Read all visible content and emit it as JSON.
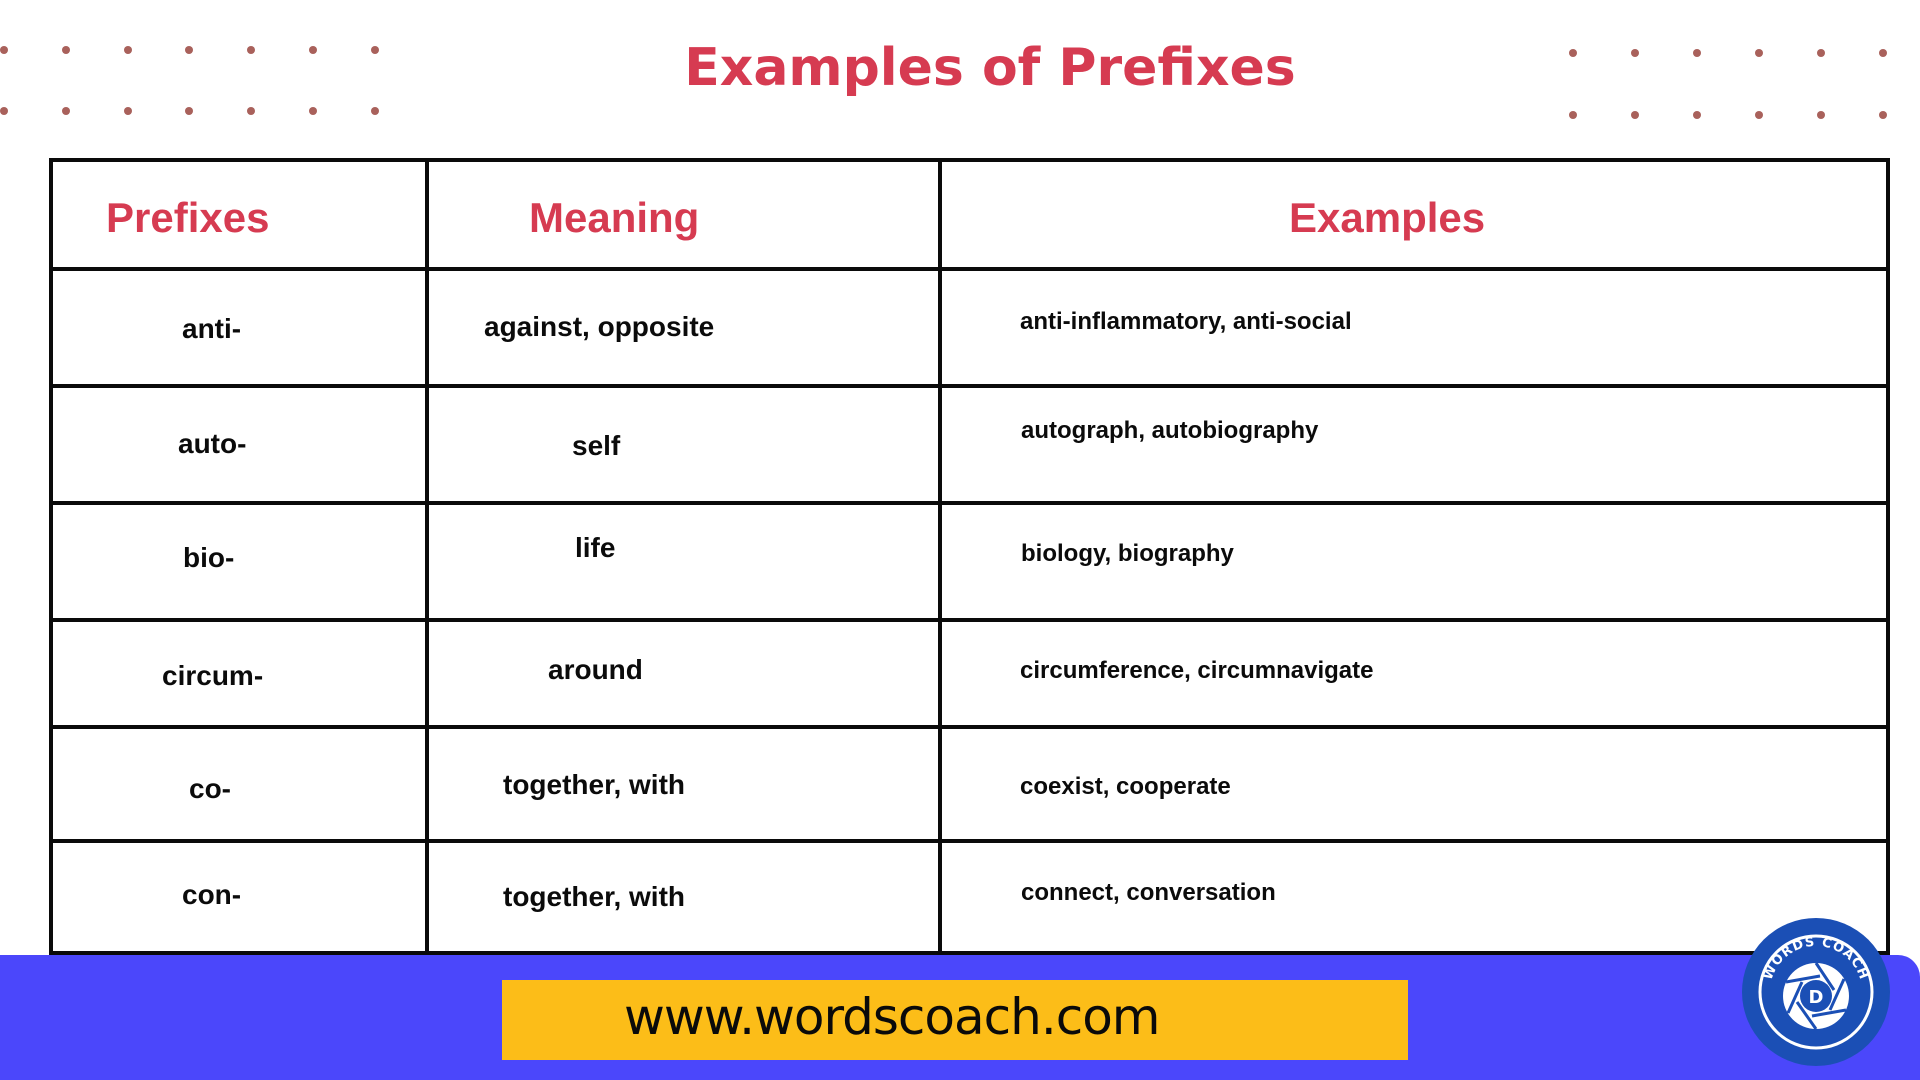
{
  "title": "Examples of Prefixes",
  "colors": {
    "title": "#d63b51",
    "header_text": "#d63b51",
    "dots": "#a9615b",
    "footer_band": "#4b47fb",
    "url_bar": "#fcbd18",
    "logo": "#1b4fb5"
  },
  "table": {
    "headers": [
      "Prefixes",
      "Meaning",
      "Examples"
    ],
    "rows": [
      {
        "prefix": "anti-",
        "meaning": "against, opposite",
        "examples": "anti-inflammatory, anti-social"
      },
      {
        "prefix": "auto-",
        "meaning": "self",
        "examples": "autograph, autobiography"
      },
      {
        "prefix": "bio-",
        "meaning": "life",
        "examples": "biology, biography"
      },
      {
        "prefix": "circum-",
        "meaning": "around",
        "examples": "circumference, circumnavigate"
      },
      {
        "prefix": "co-",
        "meaning": "together, with",
        "examples": "coexist, cooperate"
      },
      {
        "prefix": "con-",
        "meaning": "together, with",
        "examples": "connect, conversation"
      }
    ]
  },
  "footer": {
    "url": "www.wordscoach.com",
    "logo": {
      "ring_text": "WORDS COACH",
      "center_letter": "D",
      "icon": "camera-aperture-icon"
    }
  }
}
